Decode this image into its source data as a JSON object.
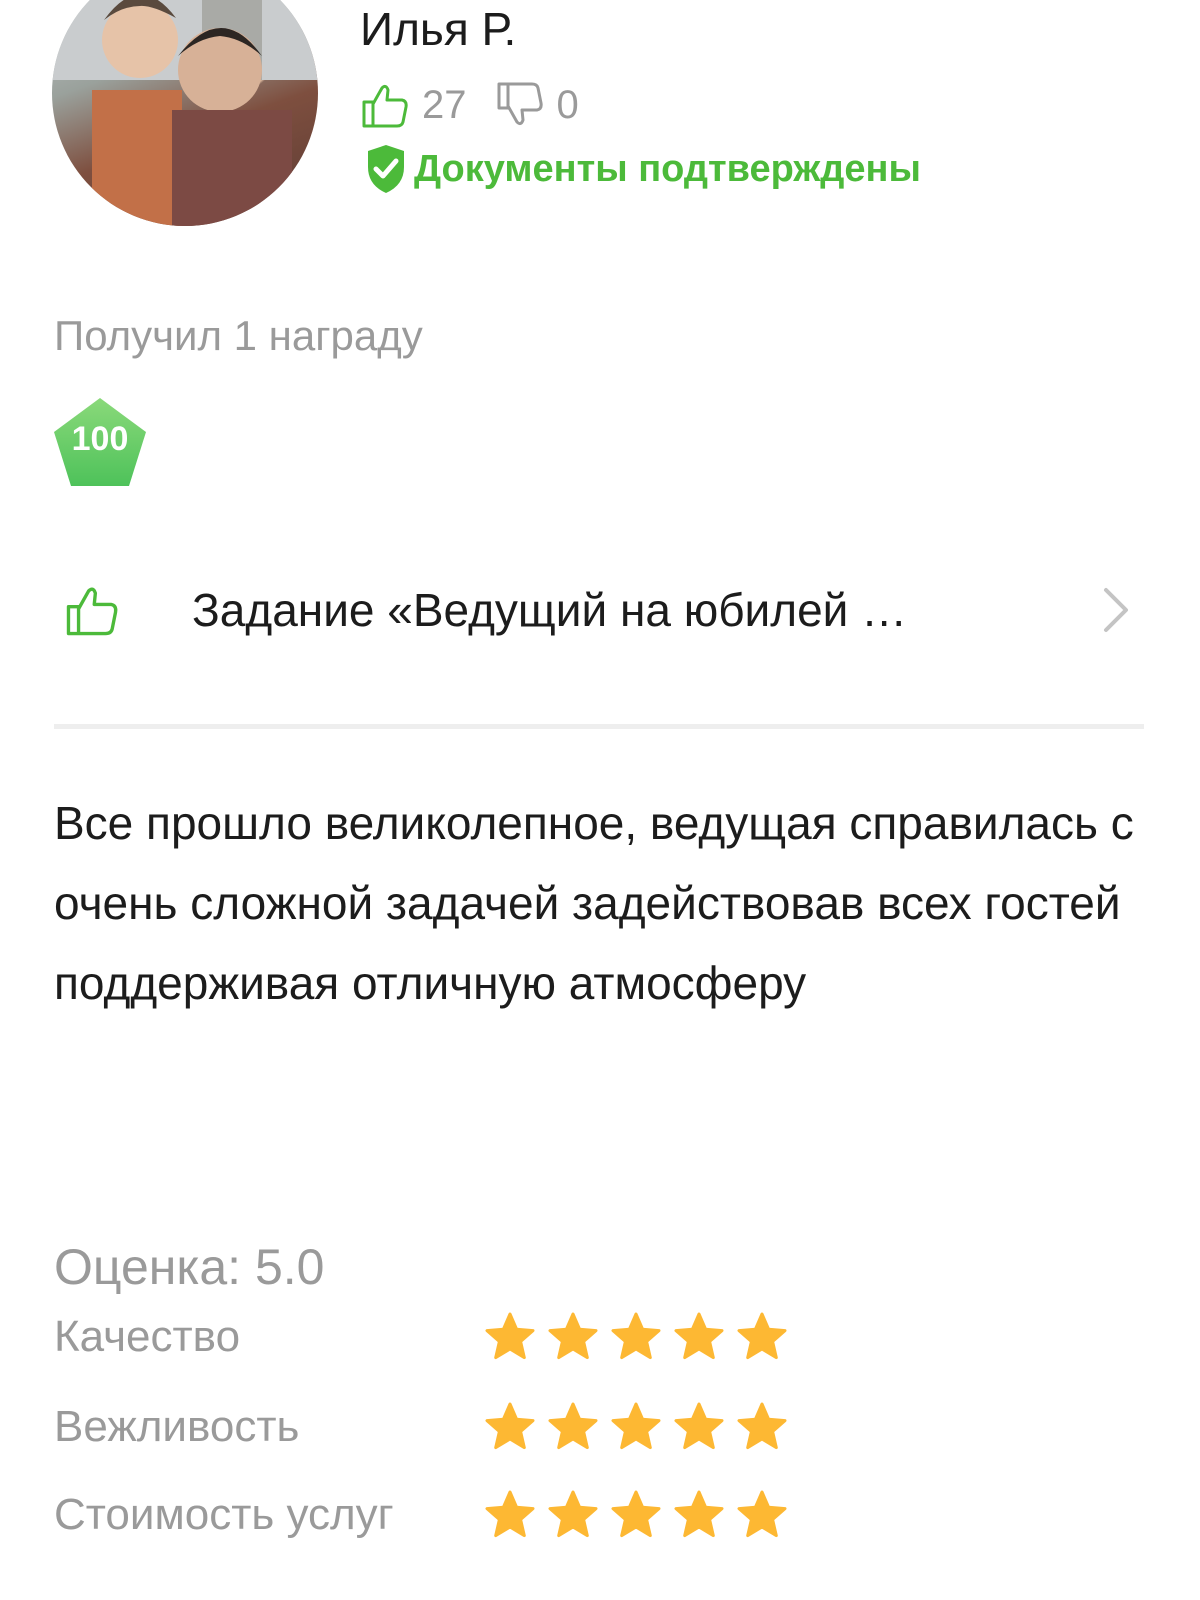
{
  "user": {
    "name": "Илья Р.",
    "likes": "27",
    "dislikes": "0",
    "verified_label": "Документы подтверждены"
  },
  "awards": {
    "title": "Получил 1 награду",
    "badge_value": "100"
  },
  "task": {
    "title": "Задание «Ведущий на юбилей …"
  },
  "review": {
    "text": "Все прошло великолепное, ведущая справилась с очень сложной задачей задействовав всех гостей поддерживая отличную атмосферу"
  },
  "rating": {
    "title": "Оценка: 5.0",
    "criteria": [
      {
        "label": "Качество",
        "stars": 5
      },
      {
        "label": "Вежливость",
        "stars": 5
      },
      {
        "label": "Стоимость услуг",
        "stars": 5
      }
    ]
  },
  "colors": {
    "accent_green": "#4cba3a",
    "star_yellow": "#fdb833",
    "muted_text": "#9a9a9a"
  },
  "icons": [
    "thumbs-up-icon",
    "thumbs-down-icon",
    "shield-check-icon",
    "chevron-right-icon",
    "star-icon"
  ]
}
